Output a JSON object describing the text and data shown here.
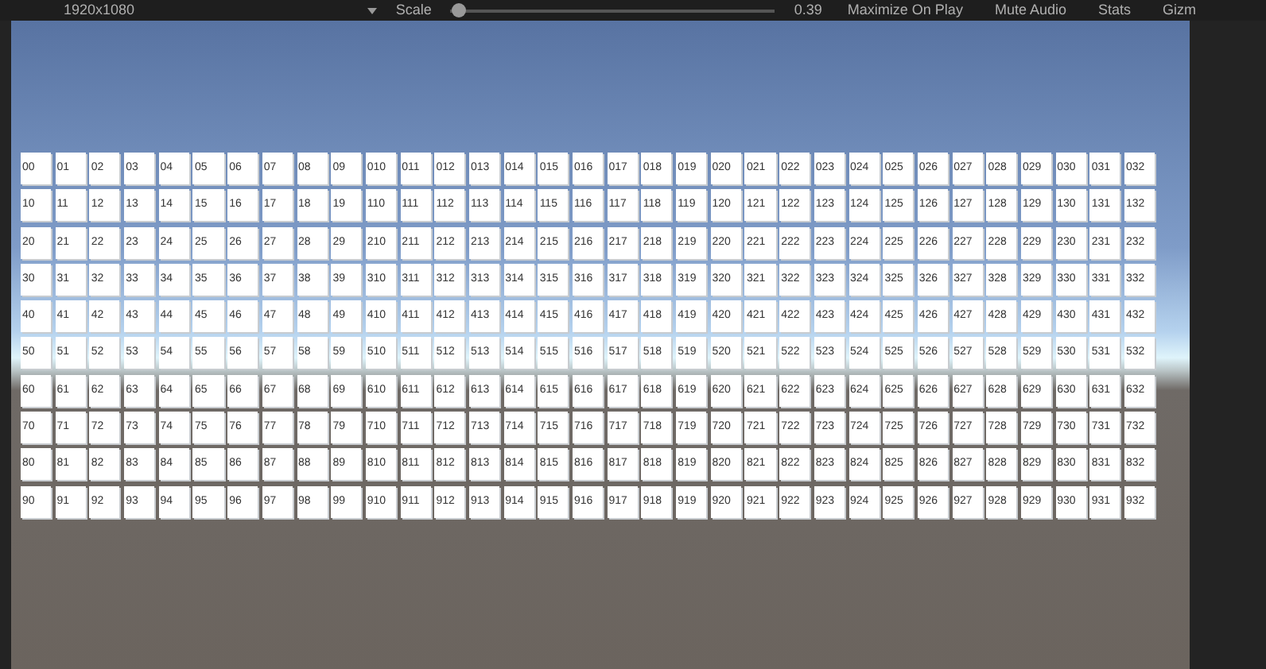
{
  "toolbar": {
    "resolution": "1920x1080",
    "scale_label": "Scale",
    "scale_slider": {
      "level": 0.02
    },
    "scale_value": "0.39",
    "buttons": [
      "Maximize On Play",
      "Mute Audio",
      "Stats",
      "Gizm"
    ]
  },
  "grid": [
    [
      "00",
      "01",
      "02",
      "03",
      "04",
      "05",
      "06",
      "07",
      "08",
      "09",
      "010",
      "011",
      "012",
      "013",
      "014",
      "015",
      "016",
      "017",
      "018",
      "019",
      "020",
      "021",
      "022",
      "023",
      "024",
      "025",
      "026",
      "027",
      "028",
      "029",
      "030",
      "031",
      "032"
    ],
    [
      "10",
      "11",
      "12",
      "13",
      "14",
      "15",
      "16",
      "17",
      "18",
      "19",
      "110",
      "111",
      "112",
      "113",
      "114",
      "115",
      "116",
      "117",
      "118",
      "119",
      "120",
      "121",
      "122",
      "123",
      "124",
      "125",
      "126",
      "127",
      "128",
      "129",
      "130",
      "131",
      "132"
    ],
    [
      "20",
      "21",
      "22",
      "23",
      "24",
      "25",
      "26",
      "27",
      "28",
      "29",
      "210",
      "211",
      "212",
      "213",
      "214",
      "215",
      "216",
      "217",
      "218",
      "219",
      "220",
      "221",
      "222",
      "223",
      "224",
      "225",
      "226",
      "227",
      "228",
      "229",
      "230",
      "231",
      "232"
    ],
    [
      "30",
      "31",
      "32",
      "33",
      "34",
      "35",
      "36",
      "37",
      "38",
      "39",
      "310",
      "311",
      "312",
      "313",
      "314",
      "315",
      "316",
      "317",
      "318",
      "319",
      "320",
      "321",
      "322",
      "323",
      "324",
      "325",
      "326",
      "327",
      "328",
      "329",
      "330",
      "331",
      "332"
    ],
    [
      "40",
      "41",
      "42",
      "43",
      "44",
      "45",
      "46",
      "47",
      "48",
      "49",
      "410",
      "411",
      "412",
      "413",
      "414",
      "415",
      "416",
      "417",
      "418",
      "419",
      "420",
      "421",
      "422",
      "423",
      "424",
      "425",
      "426",
      "427",
      "428",
      "429",
      "430",
      "431",
      "432"
    ],
    [
      "50",
      "51",
      "52",
      "53",
      "54",
      "55",
      "56",
      "57",
      "58",
      "59",
      "510",
      "511",
      "512",
      "513",
      "514",
      "515",
      "516",
      "517",
      "518",
      "519",
      "520",
      "521",
      "522",
      "523",
      "524",
      "525",
      "526",
      "527",
      "528",
      "529",
      "530",
      "531",
      "532"
    ],
    [
      "60",
      "61",
      "62",
      "63",
      "64",
      "65",
      "66",
      "67",
      "68",
      "69",
      "610",
      "611",
      "612",
      "613",
      "614",
      "615",
      "616",
      "617",
      "618",
      "619",
      "620",
      "621",
      "622",
      "623",
      "624",
      "625",
      "626",
      "627",
      "628",
      "629",
      "630",
      "631",
      "632"
    ],
    [
      "70",
      "71",
      "72",
      "73",
      "74",
      "75",
      "76",
      "77",
      "78",
      "79",
      "710",
      "711",
      "712",
      "713",
      "714",
      "715",
      "716",
      "717",
      "718",
      "719",
      "720",
      "721",
      "722",
      "723",
      "724",
      "725",
      "726",
      "727",
      "728",
      "729",
      "730",
      "731",
      "732"
    ],
    [
      "80",
      "81",
      "82",
      "83",
      "84",
      "85",
      "86",
      "87",
      "88",
      "89",
      "810",
      "811",
      "812",
      "813",
      "814",
      "815",
      "816",
      "817",
      "818",
      "819",
      "820",
      "821",
      "822",
      "823",
      "824",
      "825",
      "826",
      "827",
      "828",
      "829",
      "830",
      "831",
      "832"
    ],
    [
      "90",
      "91",
      "92",
      "93",
      "94",
      "95",
      "96",
      "97",
      "98",
      "99",
      "910",
      "911",
      "912",
      "913",
      "914",
      "915",
      "916",
      "917",
      "918",
      "919",
      "920",
      "921",
      "922",
      "923",
      "924",
      "925",
      "926",
      "927",
      "928",
      "929",
      "930",
      "931",
      "932"
    ]
  ]
}
